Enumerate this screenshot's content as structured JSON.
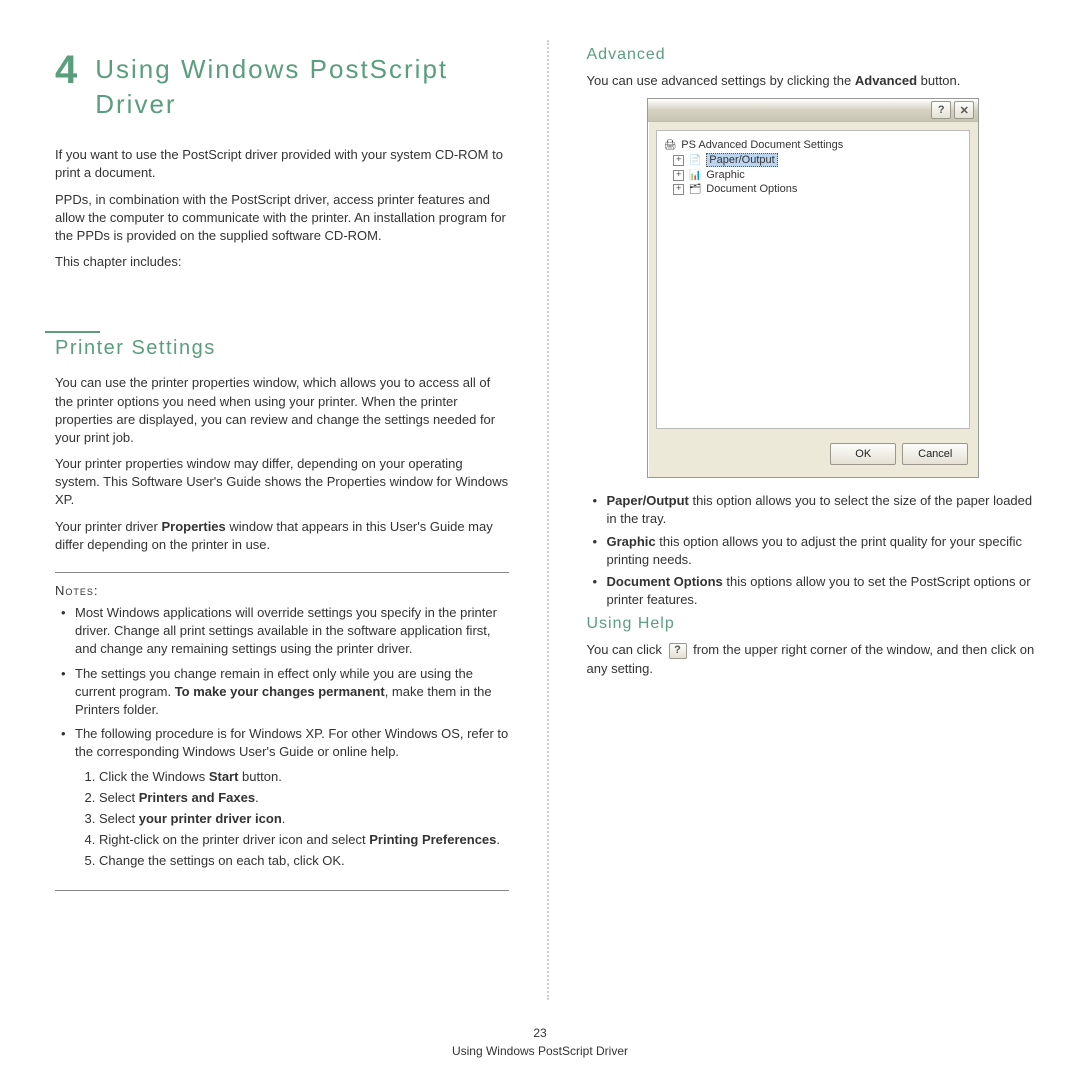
{
  "chapter_num": "4",
  "chapter_title": "Using Windows PostScript Driver",
  "intro_p1": "If you want to use the PostScript driver provided with your system CD-ROM to print a document.",
  "intro_p2": "PPDs, in combination with the PostScript driver, access printer features and allow the computer to communicate with the printer. An installation program for the PPDs is provided on the supplied software CD-ROM.",
  "intro_p3": "This chapter includes:",
  "h2_printer_settings": "Printer Settings",
  "ps_p1": "You can use the printer properties window, which allows you to access all of the printer options you need when using your printer. When the printer properties are displayed, you can review and change the settings needed for your print job.",
  "ps_p2": "Your printer properties window may differ, depending on your operating system. This Software User's Guide shows the Properties window for Windows XP.",
  "ps_p3_a": "Your printer driver ",
  "ps_p3_b": "Properties",
  "ps_p3_c": " window that appears in this User's Guide may differ depending on the printer in use.",
  "notes_label": "Notes:",
  "note1": "Most Windows applications will override settings you specify in the printer driver. Change all print settings available in the software application first, and change any remaining settings using the printer driver.",
  "note2_a": "The settings you change remain in effect only while you are using the current program. ",
  "note2_b": "To make your changes permanent",
  "note2_c": ", make them in the Printers folder.",
  "note3": "The following procedure is for Windows XP. For other Windows OS, refer to the corresponding Windows User's Guide or online help.",
  "step1_a": "Click the Windows ",
  "step1_b": "Start",
  "step1_c": " button.",
  "step2_a": "Select ",
  "step2_b": "Printers and Faxes",
  "step2_c": ".",
  "step3_a": "Select ",
  "step3_b": "your printer driver icon",
  "step3_c": ".",
  "step4_a": "Right-click on the printer driver icon and select ",
  "step4_b": "Printing Preferences",
  "step4_c": ".",
  "step5": "Change the settings on each tab, click OK.",
  "h3_advanced": "Advanced",
  "adv_p1_a": "You can use advanced settings by clicking the ",
  "adv_p1_b": "Advanced",
  "adv_p1_c": " button.",
  "dlg_root": "PS Advanced Document Settings",
  "dlg_item1": "Paper/Output",
  "dlg_item2": "Graphic",
  "dlg_item3": "Document Options",
  "dlg_ok": "OK",
  "dlg_cancel": "Cancel",
  "adv_li1_a": "Paper/Output",
  "adv_li1_b": " this option allows you to select the size of the paper loaded in the tray.",
  "adv_li2_a": "Graphic",
  "adv_li2_b": " this option allows you to adjust the print quality for your specific printing needs.",
  "adv_li3_a": "Document Options",
  "adv_li3_b": " this options allow you to set the PostScript options or printer features.",
  "h3_help": "Using Help",
  "help_p_a": "You can click ",
  "help_p_b": " from the upper right corner of the window, and then click on any setting.",
  "page_num": "23",
  "footer_text": "Using Windows PostScript Driver"
}
